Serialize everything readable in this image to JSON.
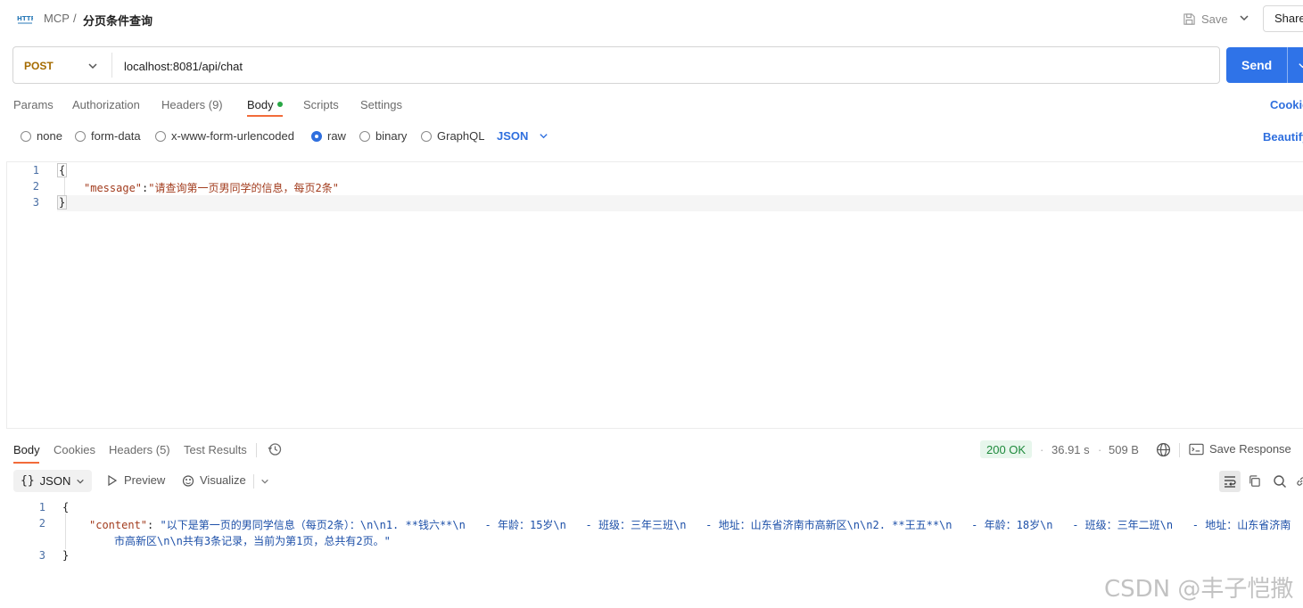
{
  "header": {
    "breadcrumb_parent": "MCP",
    "breadcrumb_sep": "/",
    "title": "分页条件查询",
    "save_label": "Save",
    "share_label": "Share"
  },
  "request": {
    "method": "POST",
    "url": "localhost:8081/api/chat",
    "send_label": "Send"
  },
  "request_tabs": {
    "params": "Params",
    "authorization": "Authorization",
    "headers": "Headers (9)",
    "body": "Body",
    "scripts": "Scripts",
    "settings": "Settings",
    "cookies": "Cookies"
  },
  "body_types": {
    "none": "none",
    "form_data": "form-data",
    "urlencoded": "x-www-form-urlencoded",
    "raw": "raw",
    "binary": "binary",
    "graphql": "GraphQL",
    "selected": "raw",
    "language": "JSON",
    "beautify": "Beautify"
  },
  "request_body": {
    "line_numbers": [
      "1",
      "2",
      "3"
    ],
    "open_brace": "{",
    "key": "\"message\"",
    "colon": ":",
    "value": "\"请查询第一页男同学的信息，每页2条\"",
    "close_brace": "}"
  },
  "response_tabs": {
    "body": "Body",
    "cookies": "Cookies",
    "headers": "Headers (5)",
    "test_results": "Test Results"
  },
  "response_meta": {
    "status": "200 OK",
    "time": "36.91 s",
    "size": "509 B",
    "dot": "·",
    "save_response": "Save Response"
  },
  "response_toolbar": {
    "format": "JSON",
    "format_braces": "{}",
    "preview": "Preview",
    "visualize": "Visualize"
  },
  "response_body": {
    "line_numbers": [
      "1",
      "2",
      "3"
    ],
    "open_brace": "{",
    "key": "\"content\"",
    "colon": ": ",
    "value_line1": "\"以下是第一页的男同学信息（每页2条）：\\n\\n1. **钱六**\\n   - 年龄：15岁\\n   - 班级：三年三班\\n   - 地址：山东省济南市高新区\\n\\n2. **王五**\\n   - 年龄：18岁\\n   - 班级：三年二班\\n   - 地址：山东省济南",
    "value_line2": "市高新区\\n\\n共有3条记录，当前为第1页，总共有2页。\"",
    "close_brace": "}"
  },
  "watermark": "CSDN @丰子恺撒",
  "colors": {
    "send_blue": "#2f73e8",
    "link_blue": "#2f6fde",
    "active_tab_underline": "#f26b3a",
    "method_color": "#a56b00",
    "status_green": "#1e8a3c"
  }
}
